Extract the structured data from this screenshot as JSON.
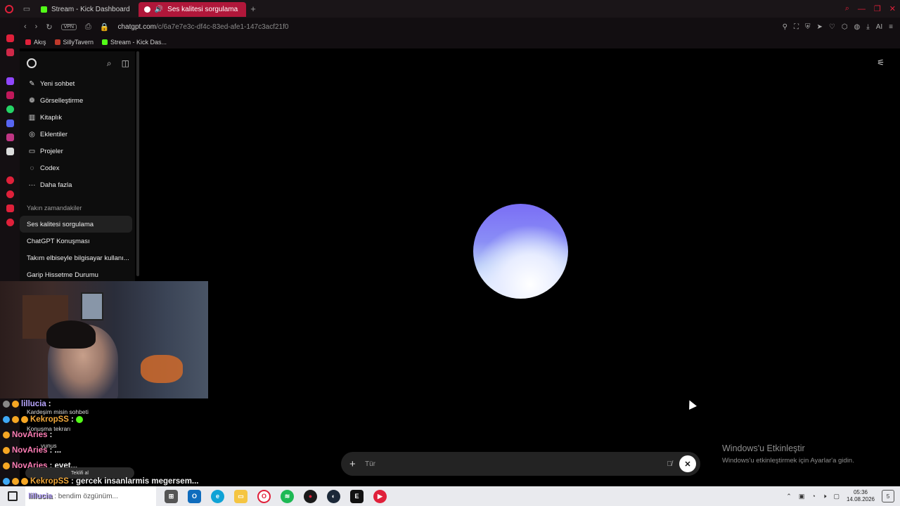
{
  "browser": {
    "tabs": [
      {
        "label": "Stream - Kick Dashboard",
        "active": false
      },
      {
        "label": "Ses kalitesi sorgulama",
        "active": true
      }
    ],
    "vpn_label": "VPN",
    "url_host": "chatgpt.com",
    "url_path": "/c/6a7e7e3c-df4c-83ed-afe1-147c3acf21f0",
    "ai_label": "AI",
    "bookmarks": [
      {
        "label": "Akış",
        "color": "#e0203a"
      },
      {
        "label": "SillyTavern",
        "color": "#c0392b"
      },
      {
        "label": "Stream - Kick Das...",
        "color": "#53fc18"
      }
    ]
  },
  "chatgpt": {
    "nav": [
      {
        "label": "Yeni sohbet",
        "icon": "edit-icon"
      },
      {
        "label": "Görselleştirme",
        "icon": "image-icon"
      },
      {
        "label": "Kitaplık",
        "icon": "library-icon"
      },
      {
        "label": "Eklentiler",
        "icon": "plugins-icon"
      },
      {
        "label": "Projeler",
        "icon": "folder-icon"
      },
      {
        "label": "Codex",
        "icon": "codex-icon"
      },
      {
        "label": "Daha fazla",
        "icon": "more-icon"
      }
    ],
    "recent_heading": "Yakın zamandakiler",
    "recent": [
      {
        "label": "Ses kalitesi sorgulama",
        "active": true
      },
      {
        "label": "ChatGPT Konuşması",
        "active": false
      },
      {
        "label": "Takım elbiseyle bilgisayar kullanı...",
        "active": false
      },
      {
        "label": "Garip Hissetme Durumu",
        "active": false
      }
    ],
    "composer_placeholder": "Tür"
  },
  "watermark": {
    "title": "Windows'u Etkinleştir",
    "subtitle": "Windows'u etkinleştirmek için Ayarlar'a gidin."
  },
  "stream_chat": {
    "lines": [
      {
        "user": "lillucia",
        "msg": ":",
        "color": "#b9a6ff"
      },
      {
        "user": "KekropSS",
        "msg": ":",
        "color": "#f2a93b"
      },
      {
        "user": "NovAries",
        "msg": ":",
        "color": "#ff7eb6"
      },
      {
        "user": "NovAries",
        "msg": ": ...",
        "color": "#ff7eb6"
      },
      {
        "user": "NovAries",
        "msg": ": evet...",
        "color": "#ff7eb6"
      },
      {
        "user": "KekropSS",
        "msg": ": gercek insanlarmis megersem...",
        "color": "#f2a93b"
      },
      {
        "user": "lillucia",
        "msg": ": bendim özgünüm...",
        "color": "#b9a6ff"
      }
    ],
    "sub_labels": {
      "kardesim": "Kardeşim misin sohbeti",
      "konusma": "Konuşma tekrarı",
      "yunus": "yunus",
      "teklif": "Teklifi al"
    }
  },
  "taskbar": {
    "time": "05:36",
    "date": "14.08.2026",
    "notification_count": "5"
  }
}
